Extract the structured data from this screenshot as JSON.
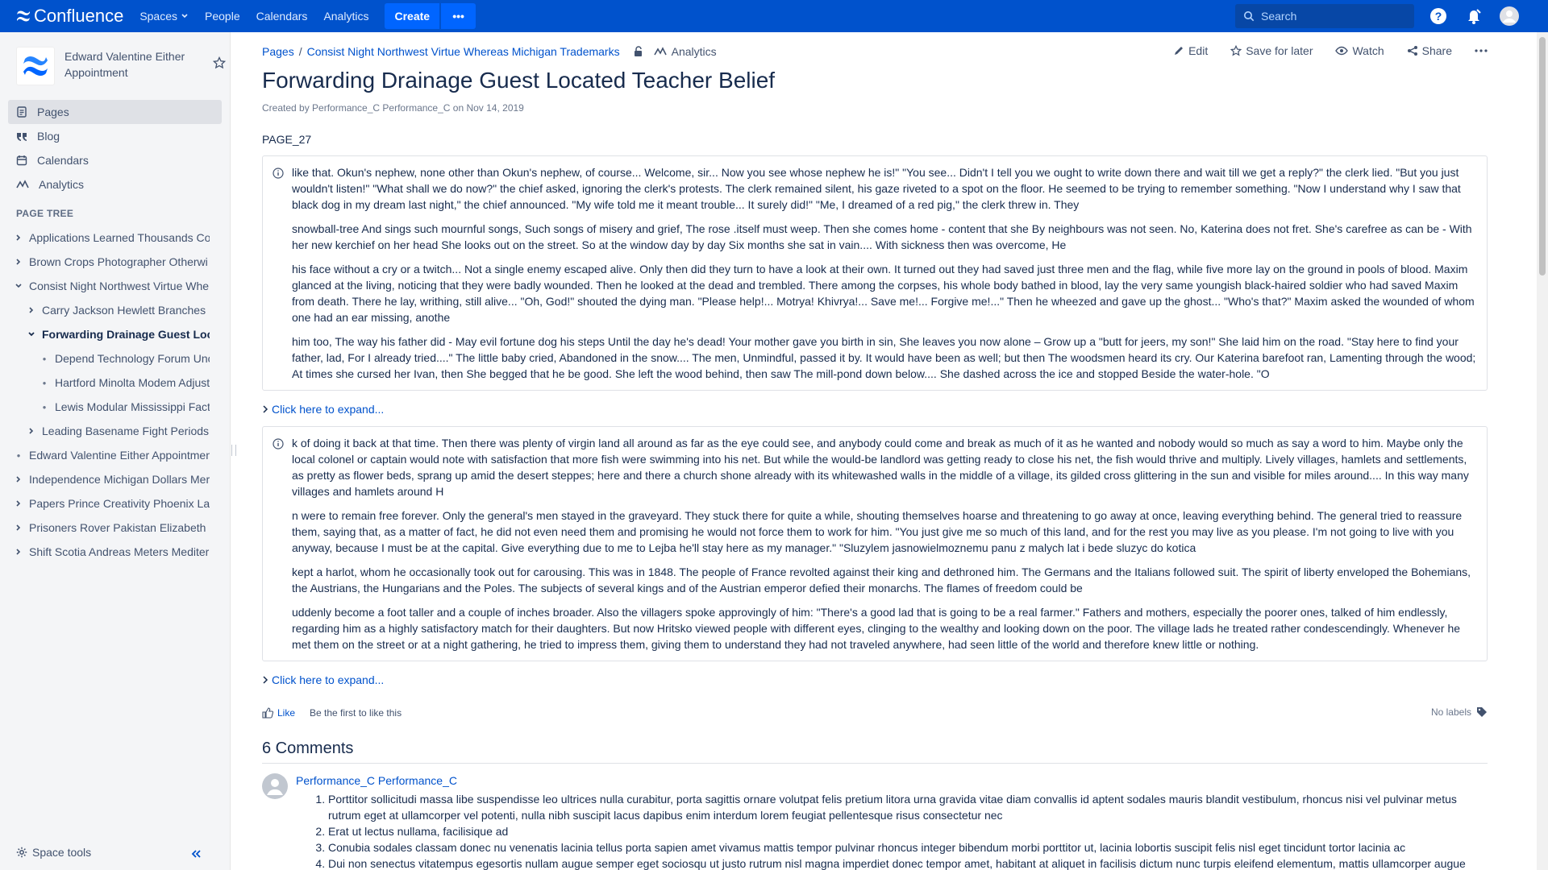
{
  "topbar": {
    "brand": "Confluence",
    "nav": [
      "Spaces",
      "People",
      "Calendars",
      "Analytics"
    ],
    "create_label": "Create",
    "more_label": "•••",
    "search_placeholder": "Search"
  },
  "sidebar": {
    "space_name": "Edward Valentine Either Appointment",
    "nav": [
      {
        "label": "Pages",
        "icon": "pages-icon",
        "active": true
      },
      {
        "label": "Blog",
        "icon": "quote-icon"
      },
      {
        "label": "Calendars",
        "icon": "calendar-icon"
      },
      {
        "label": "Analytics",
        "icon": "analytics-icon"
      }
    ],
    "page_tree_title": "PAGE TREE",
    "tree": [
      {
        "label": "Applications Learned Thousands Co",
        "level": 0,
        "type": "collapsed"
      },
      {
        "label": "Brown Crops Photographer Otherwi",
        "level": 0,
        "type": "collapsed"
      },
      {
        "label": "Consist Night Northwest Virtue Whe",
        "level": 0,
        "type": "expanded"
      },
      {
        "label": "Carry Jackson Hewlett Branches",
        "level": 1,
        "type": "collapsed"
      },
      {
        "label": "Forwarding Drainage Guest Loc",
        "level": 1,
        "type": "expanded",
        "bold": true
      },
      {
        "label": "Depend Technology Forum Unc",
        "level": 2,
        "type": "leaf"
      },
      {
        "label": "Hartford Minolta Modem Adjusta",
        "level": 2,
        "type": "leaf"
      },
      {
        "label": "Lewis Modular Mississippi Facto",
        "level": 2,
        "type": "leaf"
      },
      {
        "label": "Leading Basename Fight Periods",
        "level": 1,
        "type": "collapsed"
      },
      {
        "label": "Edward Valentine Either Appointmen",
        "level": 0,
        "type": "leaf"
      },
      {
        "label": "Independence Michigan Dollars Mer",
        "level": 0,
        "type": "collapsed"
      },
      {
        "label": "Papers Prince Creativity Phoenix La",
        "level": 0,
        "type": "collapsed"
      },
      {
        "label": "Prisoners Rover Pakistan Elizabeth",
        "level": 0,
        "type": "collapsed"
      },
      {
        "label": "Shift Scotia Andreas Meters Mediter",
        "level": 0,
        "type": "collapsed"
      }
    ],
    "space_tools": "Space tools"
  },
  "page": {
    "breadcrumb": [
      "Pages",
      "Consist Night Northwest Virtue Whereas Michigan Trademarks"
    ],
    "breadcrumb_analytics": "Analytics",
    "actions": {
      "edit": "Edit",
      "save": "Save for later",
      "watch": "Watch",
      "share": "Share"
    },
    "title": "Forwarding Drainage Guest Located Teacher Belief",
    "byline": "Created by Performance_C Performance_C on Nov 14, 2019",
    "label": "PAGE_27",
    "panel1": [
      "like that. Okun's nephew, none other than Okun's nephew, of course... Welcome, sir... Now you see whose nephew he is!\" \"You see... Didn't I tell you we ought to write down there and wait till we get a reply?\" the clerk lied. \"But you just wouldn't listen!\" \"What shall we do now?\" the chief asked, ignoring the clerk's protests. The clerk remained silent, his gaze riveted to a spot on the floor. He seemed to be trying to remember something. \"Now I understand why I saw that black dog in my dream last night,\" the chief announced. \"My wife told me it meant trouble... It surely did!\" \"Me, I dreamed of a red pig,\" the clerk threw in. They",
      "snowball-tree And sings such mournful songs, Such songs of misery and grief, The rose .itself must weep. Then she comes home - content that she By neighbours was not seen. No, Katerina does not fret. She's carefree as can be - With her new kerchief on her head She looks out on the street. So at the window day by day Six months she sat in vain.... With sickness then was overcome, He",
      "his face without a cry or a twitch... Not a single enemy escaped alive. Only then did they turn to have a look at their own. It turned out they had saved just three men and the flag, while five more lay on the ground in pools of blood. Maxim glanced at the living, noticing that they were badly wounded. Then he looked at the dead and trembled. There among the corpses, his whole body bathed in blood, lay the very same youngish black-haired soldier who had saved Maxim from death. There he lay, writhing, still alive... \"Oh, God!\" shouted the dying man. \"Please help!... Motrya! Khivrya!... Save me!... Forgive me!...\" Then he wheezed and gave up the ghost... \"Who's that?\" Maxim asked the wounded of whom one had an ear missing, anothe",
      "him too, The way his father did - May evil fortune dog his steps Until the day he's dead! Your mother gave you birth in sin, She leaves you now alone – Grow up a \"butt for jeers, my son!\" She laid him on the road. \"Stay here to find your father, lad, For I already tried....\" The little baby cried, Abandoned in the snow.... The men, Unmindful, passed it by. It would have been as well; but then The woodsmen heard its cry. Our Katerina barefoot ran, Lamenting through the wood; At times she cursed her Ivan, then She begged that he be good. She left the wood behind, then saw The mill-pond down below.... She dashed across the ice and stopped Beside the water-hole. \"O"
    ],
    "expand_label": "Click here to expand...",
    "panel2": [
      "k of doing it back at that time. Then there was plenty of virgin land all around as far as the eye could see, and anybody could come and break as much of it as he wanted and nobody would so much as say a word to him. Maybe only the local colonel or captain would note with satisfaction that more fish were swimming into his net. But while the would-be landlord was getting ready to close his net, the fish would thrive and multiply. Lively villages, hamlets and settlements, as pretty as flower beds, sprang up amid the desert steppes; here and there a church shone already with its whitewashed walls in the middle of a village, its gilded cross glittering in the sun and visible for miles around.... In this way many villages and hamlets around H",
      "n were to remain free forever. Only the general's men stayed in the graveyard. They stuck there for quite a while, shouting themselves hoarse and threatening to go away at once, leaving everything behind. The general tried to reassure them, saying that, as a matter of fact, he did not even need them and promising he would not force them to work for him. \"You just give me so much of this land, and for the rest you may live as you please. I'm not going to live with you anyway, because I must be at the capital. Give everything due to me to Lejba he'll stay here as my manager.\" \"Sluzylem jasnowielmoznemu panu z malych lat i bede sluzyc do kotica",
      "kept a harlot, whom he occasionally took out for carousing. This was in 1848. The people of France revolted against their king and dethroned him. The Germans and the Italians followed suit. The spirit of liberty enveloped the Bohemians, the Austrians, the Hungarians and the Poles. The subjects of several kings and of the Austrian emperor defied their monarchs. The flames of freedom could be",
      "uddenly become a foot taller and a couple of inches broader. Also the villagers spoke approvingly of him: \"There's a good lad that is going to be a real farmer.\" Fathers and mothers, especially the poorer ones, talked of him endlessly, regarding him as a highly satisfactory match for their daughters. But now Hritsko viewed people with different eyes, clinging to the wealthy and looking down on the poor. The village lads he treated rather condescendingly. Whenever he met them on the street or at a night gathering, he tried to impress them, giving them to understand they had not traveled anywhere, had seen little of the world and therefore knew little or nothing."
    ],
    "like_label": "Like",
    "like_text": "Be the first to like this",
    "no_labels": "No labels",
    "comments_title": "6 Comments",
    "comment": {
      "author": "Performance_C Performance_C",
      "items": [
        "Porttitor sollicitudi massa libe suspendisse leo ultrices nulla curabitur, porta sagittis ornare volutpat felis pretium litora urna gravida vitae diam convallis id aptent sodales mauris blandit vestibulum, rhoncus nisi vel pulvinar metus rutrum eget at ullamcorper vel potenti, nulla nibh suscipit lacus dapibus enim interdum lorem feugiat pellentesque risus consectetur nec",
        "Erat ut lectus nullama, facilisique ad",
        "Conubia sodales classam donec nu venenatis lacinia tellus porta sapien amet vivamus mattis tempor pulvinar rhoncus integer bibendum morbi porttitor ut, lacinia lobortis suscipit felis nisl eget tincidunt tortor lacinia ac",
        "Dui non senectus vitatempus egesortis nullam augue semper eget sociosqu ut justo rutrum nisl magna imperdiet donec tempor amet, habitant at aliquet in facilisis dictum nunc turpis eleifend elementum, mattis ullamcorper augue"
      ]
    }
  },
  "colors": {
    "primary": "#0052cc",
    "link": "#0052cc",
    "sidebar_bg": "#f4f5f7"
  }
}
